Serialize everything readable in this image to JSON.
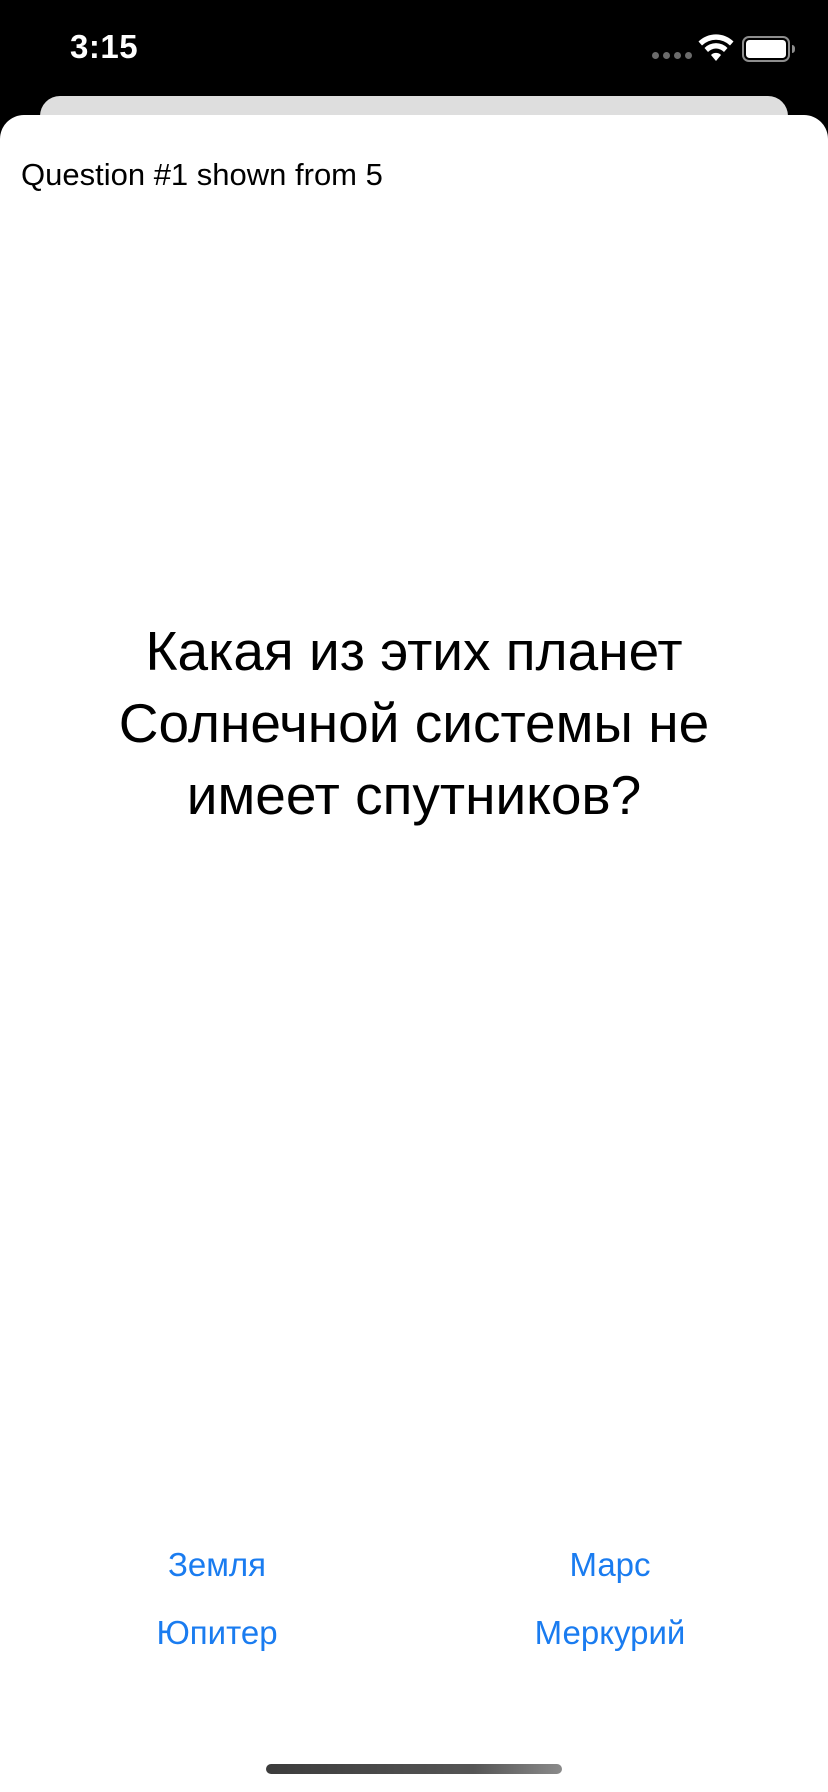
{
  "status_bar": {
    "time": "3:15",
    "icons": [
      "signal-dots-icon",
      "wifi-icon",
      "battery-icon"
    ]
  },
  "quiz": {
    "counter": "Question #1 shown from 5",
    "question": "Какая из этих планет Солнечной системы не имеет спутников?",
    "answers": [
      "Земля",
      "Марс",
      "Юпитер",
      "Меркурий"
    ]
  },
  "colors": {
    "accent": "#1a7cf0",
    "background": "#ffffff",
    "status_bar_bg": "#000000",
    "back_card": "#dedede"
  }
}
